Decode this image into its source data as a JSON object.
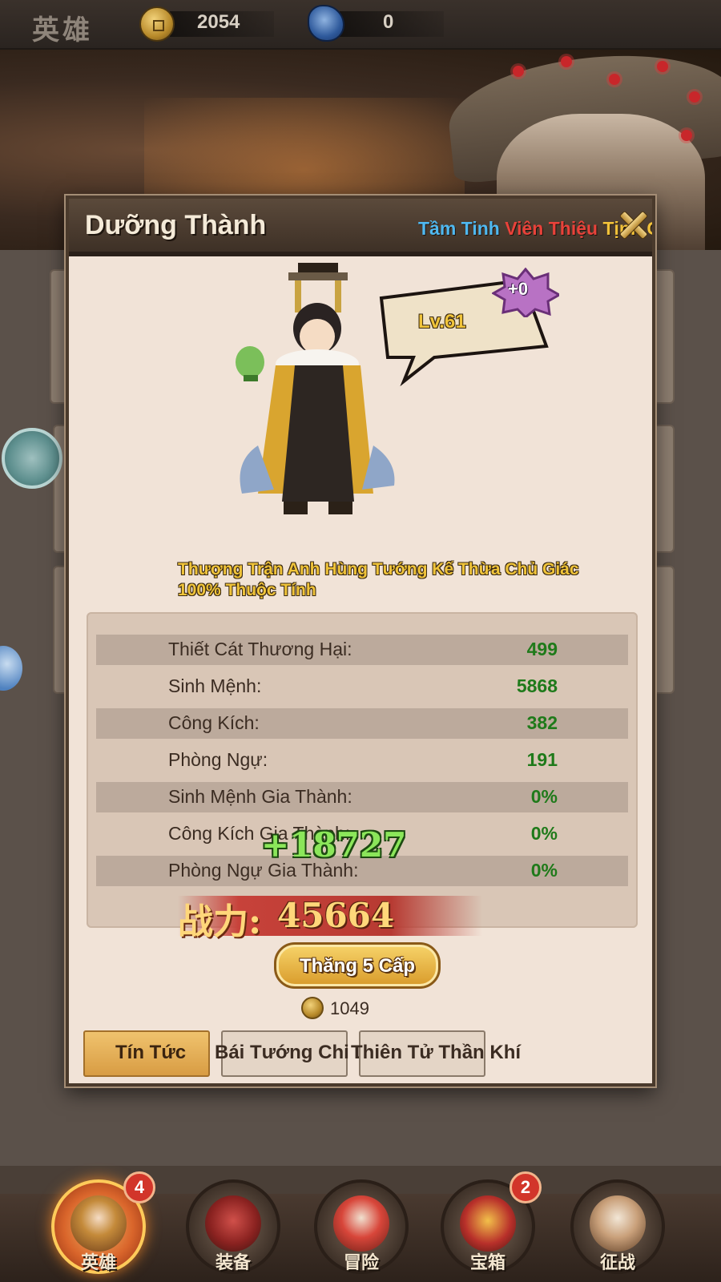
{
  "topbar": {
    "screen_title": "英雄",
    "coin_value": "2054",
    "gem_value": "0",
    "icons": {
      "coin": "coin-icon",
      "gem": "gem-icon"
    }
  },
  "modal": {
    "title": "Dưỡng Thành",
    "marquee": [
      {
        "text": "Tầm Tinh ",
        "color": "#4fb8f0"
      },
      {
        "text": "Viên Thiệu ",
        "color": "#e8423a"
      },
      {
        "text": "Tịnh Cấp Đạt Đa",
        "color": "#f2c23a"
      }
    ],
    "hero": {
      "level": "Lv.61",
      "star_plus": "+0"
    },
    "description": [
      "Thượng Trận Anh Hùng Tướng Kế Thừa Chủ Giác",
      "100% Thuộc Tính"
    ],
    "stats": [
      {
        "label": "Thiết Cát Thương Hại:",
        "value": "499"
      },
      {
        "label": "Sinh Mệnh:",
        "value": "5868"
      },
      {
        "label": "Công Kích:",
        "value": "382"
      },
      {
        "label": "Phòng Ngự:",
        "value": "191"
      },
      {
        "label": "Sinh Mệnh Gia Thành:",
        "value": "0%"
      },
      {
        "label": "Công Kích Gia Thành:",
        "value": "0%"
      },
      {
        "label": "Phòng Ngự Gia Thành:",
        "value": "0%"
      }
    ],
    "gain_popup": "+18727",
    "power_label": "战力:",
    "power_value": "45664",
    "upgrade_button": "Thăng 5 Cấp",
    "upgrade_cost": "1049",
    "tabs": [
      {
        "label": "Tín Tức",
        "active": true
      },
      {
        "label": "Bái Tướng Chi Lộ",
        "active": false
      },
      {
        "label": "Thiên Tử Thần Khí",
        "active": false
      }
    ]
  },
  "bottom_nav": [
    {
      "label": "英雄",
      "badge": "4",
      "active": true,
      "icon": "hero-icon"
    },
    {
      "label": "装备",
      "badge": "",
      "active": false,
      "icon": "armor-icon"
    },
    {
      "label": "冒险",
      "badge": "",
      "active": false,
      "icon": "adventure-icon"
    },
    {
      "label": "宝箱",
      "badge": "2",
      "active": false,
      "icon": "treasure-chest-icon"
    },
    {
      "label": "征战",
      "badge": "",
      "active": false,
      "icon": "war-drum-icon"
    }
  ],
  "colors": {
    "accent_gold": "#f0c43a",
    "stat_value_green": "#1f7a1a",
    "power_red": "#c7423a"
  }
}
